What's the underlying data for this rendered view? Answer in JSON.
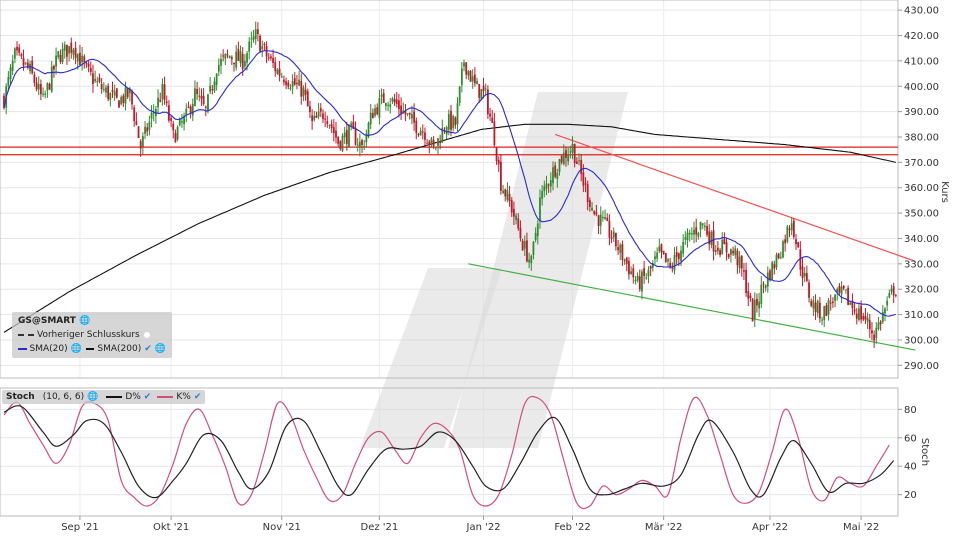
{
  "chart_data": [
    {
      "type": "candlestick",
      "instrument": "GS@SMART",
      "y_axis_label": "Kurs",
      "y_ticks": [
        "290.00",
        "300.00",
        "310.00",
        "320.00",
        "330.00",
        "340.00",
        "350.00",
        "360.00",
        "370.00",
        "380.00",
        "390.00",
        "400.00",
        "410.00",
        "420.00",
        "430.00"
      ],
      "ylim": [
        285,
        434
      ],
      "x_ticks": [
        "Sep '21",
        "Okt '21",
        "Nov '21",
        "Dez '21",
        "Jan '22",
        "Feb '22",
        "Mär '22",
        "Apr '22",
        "Mai '22"
      ],
      "legend": {
        "title": "GS@SMART",
        "items": [
          "Vorheriger Schlusskurs",
          "SMA(20)",
          "SMA(200)"
        ]
      },
      "colors": {
        "up": "#2e8b2e",
        "down": "#c0182a",
        "sma20": "#2a2ad0",
        "sma200": "#111111",
        "resistance": "#e0201a",
        "channel_top": "#f05050",
        "channel_bottom": "#40b040"
      },
      "horizontal_lines": [
        376,
        373
      ],
      "price_anchors": [
        [
          0,
          395
        ],
        [
          5,
          412
        ],
        [
          12,
          406
        ],
        [
          18,
          394
        ],
        [
          25,
          412
        ],
        [
          32,
          416
        ],
        [
          38,
          406
        ],
        [
          44,
          400
        ],
        [
          52,
          394
        ],
        [
          58,
          397
        ],
        [
          63,
          376
        ],
        [
          68,
          388
        ],
        [
          73,
          398
        ],
        [
          78,
          380
        ],
        [
          84,
          388
        ],
        [
          88,
          397
        ],
        [
          93,
          390
        ],
        [
          98,
          408
        ],
        [
          104,
          412
        ],
        [
          110,
          410
        ],
        [
          116,
          420
        ],
        [
          121,
          412
        ],
        [
          126,
          406
        ],
        [
          132,
          402
        ],
        [
          138,
          398
        ],
        [
          142,
          385
        ],
        [
          148,
          390
        ],
        [
          154,
          378
        ],
        [
          160,
          382
        ],
        [
          165,
          376
        ],
        [
          170,
          390
        ],
        [
          176,
          396
        ],
        [
          182,
          392
        ],
        [
          188,
          386
        ],
        [
          194,
          382
        ],
        [
          198,
          375
        ],
        [
          204,
          386
        ],
        [
          208,
          385
        ],
        [
          212,
          410
        ],
        [
          217,
          400
        ],
        [
          222,
          396
        ],
        [
          226,
          380
        ],
        [
          229,
          362
        ],
        [
          234,
          352
        ],
        [
          239,
          338
        ],
        [
          243,
          330
        ],
        [
          247,
          355
        ],
        [
          252,
          365
        ],
        [
          257,
          372
        ],
        [
          262,
          376
        ],
        [
          267,
          362
        ],
        [
          272,
          350
        ],
        [
          277,
          345
        ],
        [
          282,
          338
        ],
        [
          287,
          330
        ],
        [
          292,
          322
        ],
        [
          297,
          326
        ],
        [
          302,
          334
        ],
        [
          307,
          328
        ],
        [
          312,
          336
        ],
        [
          317,
          342
        ],
        [
          322,
          346
        ],
        [
          327,
          338
        ],
        [
          332,
          336
        ],
        [
          337,
          334
        ],
        [
          341,
          325
        ],
        [
          345,
          310
        ],
        [
          350,
          322
        ],
        [
          355,
          330
        ],
        [
          359,
          338
        ],
        [
          363,
          348
        ],
        [
          367,
          330
        ],
        [
          372,
          315
        ],
        [
          377,
          310
        ],
        [
          382,
          316
        ],
        [
          387,
          318
        ],
        [
          392,
          312
        ],
        [
          397,
          308
        ],
        [
          401,
          302
        ],
        [
          406,
          312
        ],
        [
          410,
          320
        ]
      ],
      "sma200_anchors": [
        [
          0,
          303
        ],
        [
          30,
          319
        ],
        [
          60,
          333
        ],
        [
          90,
          346
        ],
        [
          120,
          357
        ],
        [
          150,
          366
        ],
        [
          180,
          373
        ],
        [
          200,
          378
        ],
        [
          220,
          383
        ],
        [
          240,
          385
        ],
        [
          260,
          385
        ],
        [
          280,
          384
        ],
        [
          300,
          381
        ],
        [
          330,
          379
        ],
        [
          360,
          377
        ],
        [
          390,
          374
        ],
        [
          411,
          370
        ]
      ],
      "trendlines": [
        {
          "name": "channel-top",
          "from": [
            254,
            381
          ],
          "to": [
            420,
            331
          ]
        },
        {
          "name": "channel-bottom",
          "from": [
            214,
            330
          ],
          "to": [
            420,
            296
          ]
        }
      ]
    },
    {
      "type": "line",
      "title": "Stoch",
      "params": "(10, 6, 6)",
      "legend": [
        "D%",
        "K%"
      ],
      "y_axis_label": "Stoch",
      "y_ticks": [
        "20",
        "40",
        "60",
        "80"
      ],
      "ylim": [
        5,
        95
      ],
      "k_anchors": [
        [
          0,
          76
        ],
        [
          6,
          85
        ],
        [
          12,
          70
        ],
        [
          18,
          55
        ],
        [
          24,
          42
        ],
        [
          30,
          55
        ],
        [
          36,
          82
        ],
        [
          42,
          84
        ],
        [
          48,
          72
        ],
        [
          54,
          30
        ],
        [
          60,
          18
        ],
        [
          66,
          12
        ],
        [
          72,
          20
        ],
        [
          78,
          42
        ],
        [
          84,
          70
        ],
        [
          90,
          80
        ],
        [
          96,
          62
        ],
        [
          102,
          40
        ],
        [
          108,
          14
        ],
        [
          114,
          20
        ],
        [
          120,
          50
        ],
        [
          126,
          84
        ],
        [
          132,
          76
        ],
        [
          138,
          52
        ],
        [
          144,
          32
        ],
        [
          150,
          16
        ],
        [
          156,
          20
        ],
        [
          162,
          42
        ],
        [
          168,
          60
        ],
        [
          174,
          64
        ],
        [
          180,
          52
        ],
        [
          186,
          42
        ],
        [
          192,
          60
        ],
        [
          198,
          70
        ],
        [
          204,
          66
        ],
        [
          210,
          52
        ],
        [
          216,
          20
        ],
        [
          222,
          12
        ],
        [
          228,
          20
        ],
        [
          234,
          48
        ],
        [
          240,
          84
        ],
        [
          246,
          88
        ],
        [
          252,
          76
        ],
        [
          258,
          44
        ],
        [
          264,
          14
        ],
        [
          270,
          12
        ],
        [
          276,
          26
        ],
        [
          282,
          20
        ],
        [
          288,
          24
        ],
        [
          294,
          30
        ],
        [
          300,
          26
        ],
        [
          306,
          20
        ],
        [
          312,
          60
        ],
        [
          318,
          88
        ],
        [
          324,
          76
        ],
        [
          330,
          48
        ],
        [
          336,
          20
        ],
        [
          342,
          14
        ],
        [
          348,
          22
        ],
        [
          354,
          50
        ],
        [
          360,
          80
        ],
        [
          366,
          60
        ],
        [
          372,
          24
        ],
        [
          378,
          16
        ],
        [
          384,
          32
        ],
        [
          390,
          28
        ],
        [
          396,
          26
        ],
        [
          402,
          40
        ],
        [
          408,
          55
        ]
      ],
      "d_anchors": [
        [
          0,
          78
        ],
        [
          8,
          82
        ],
        [
          18,
          64
        ],
        [
          24,
          54
        ],
        [
          32,
          62
        ],
        [
          38,
          72
        ],
        [
          46,
          70
        ],
        [
          54,
          50
        ],
        [
          62,
          26
        ],
        [
          70,
          18
        ],
        [
          78,
          30
        ],
        [
          84,
          42
        ],
        [
          92,
          62
        ],
        [
          100,
          58
        ],
        [
          108,
          36
        ],
        [
          114,
          24
        ],
        [
          122,
          36
        ],
        [
          130,
          68
        ],
        [
          138,
          72
        ],
        [
          146,
          50
        ],
        [
          154,
          26
        ],
        [
          160,
          20
        ],
        [
          168,
          38
        ],
        [
          176,
          52
        ],
        [
          184,
          52
        ],
        [
          192,
          54
        ],
        [
          200,
          64
        ],
        [
          208,
          58
        ],
        [
          216,
          40
        ],
        [
          222,
          26
        ],
        [
          230,
          24
        ],
        [
          238,
          42
        ],
        [
          246,
          64
        ],
        [
          254,
          74
        ],
        [
          262,
          52
        ],
        [
          270,
          24
        ],
        [
          278,
          20
        ],
        [
          286,
          24
        ],
        [
          294,
          28
        ],
        [
          304,
          26
        ],
        [
          312,
          34
        ],
        [
          320,
          62
        ],
        [
          326,
          72
        ],
        [
          336,
          50
        ],
        [
          344,
          24
        ],
        [
          350,
          20
        ],
        [
          358,
          46
        ],
        [
          364,
          58
        ],
        [
          372,
          42
        ],
        [
          380,
          22
        ],
        [
          388,
          28
        ],
        [
          396,
          28
        ],
        [
          404,
          34
        ],
        [
          410,
          44
        ]
      ]
    }
  ],
  "legends": {
    "price": {
      "title": "GS@SMART",
      "prev_close": "Vorheriger Schlusskurs",
      "sma20": "SMA(20)",
      "sma200": "SMA(200)"
    },
    "stoch": {
      "title": "Stoch",
      "params": "(10, 6, 6)",
      "d": "D%",
      "k": "K%"
    }
  },
  "axes": {
    "price_label": "Kurs",
    "stoch_label": "Stoch"
  }
}
